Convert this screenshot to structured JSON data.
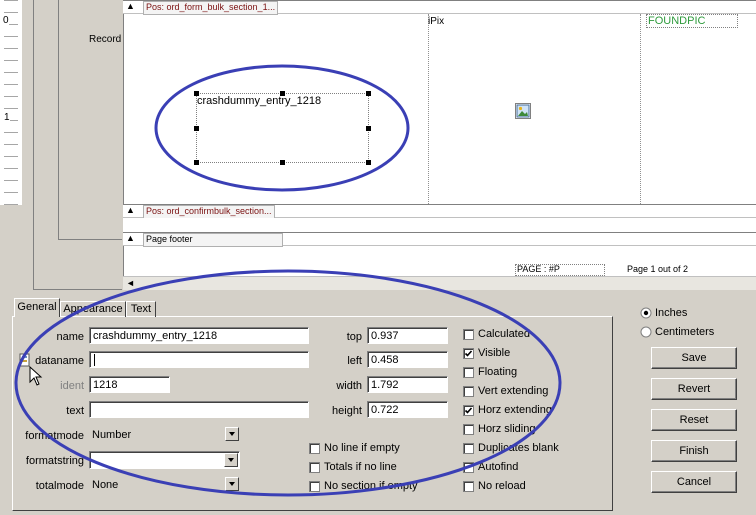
{
  "ruler": {
    "mark0": "0",
    "mark1": "1"
  },
  "band_labels": {
    "record": "Record"
  },
  "sections": {
    "detail": "Pos: ord_form_bulk_section_1...",
    "confirm": "Pos: ord_confirmbulk_section...",
    "footer": "Page footer"
  },
  "canvas": {
    "element_label": "crashdummy_entry_1218",
    "ipix": "iPix",
    "foundpic": "FOUNDPIC",
    "page_field": "PAGE : #P",
    "page_of": "Page 1 out of 2"
  },
  "tabs": {
    "general": "General",
    "appearance": "Appearance",
    "text": "Text"
  },
  "fields": {
    "name_label": "name",
    "name_value": "crashdummy_entry_1218",
    "dataname_label": "dataname",
    "dataname_value": "",
    "ident_label": "ident",
    "ident_value": "1218",
    "text_label": "text",
    "text_value": "",
    "formatmode_label": "formatmode",
    "formatmode_value": "Number",
    "formatstring_label": "formatstring",
    "formatstring_value": "",
    "totalmode_label": "totalmode",
    "totalmode_value": "None",
    "top_label": "top",
    "top_value": "0.937",
    "left_label": "left",
    "left_value": "0.458",
    "width_label": "width",
    "width_value": "1.792",
    "height_label": "height",
    "height_value": "0.722"
  },
  "options_mid": {
    "no_line": "No line if empty",
    "totals": "Totals if no line",
    "no_section": "No section if empty"
  },
  "options_right": {
    "calculated": {
      "label": "Calculated",
      "checked": false
    },
    "visible": {
      "label": "Visible",
      "checked": true
    },
    "floating": {
      "label": "Floating",
      "checked": false
    },
    "vert_extending": {
      "label": "Vert extending",
      "checked": false
    },
    "horz_extending": {
      "label": "Horz extending",
      "checked": true
    },
    "horz_sliding": {
      "label": "Horz sliding",
      "checked": false
    },
    "duplicates_blank": {
      "label": "Duplicates blank",
      "checked": false
    },
    "autofind": {
      "label": "Autofind",
      "checked": false
    },
    "no_reload": {
      "label": "No reload",
      "checked": false
    }
  },
  "units": {
    "inches": "Inches",
    "centimeters": "Centimeters",
    "selected": "inches"
  },
  "buttons": {
    "save": "Save",
    "revert": "Revert",
    "reset": "Reset",
    "finish": "Finish",
    "cancel": "Cancel"
  },
  "colors": {
    "annotation": "#3a3fb5",
    "foundpic": "#2e9a3c",
    "section_text": "#7a1010"
  }
}
